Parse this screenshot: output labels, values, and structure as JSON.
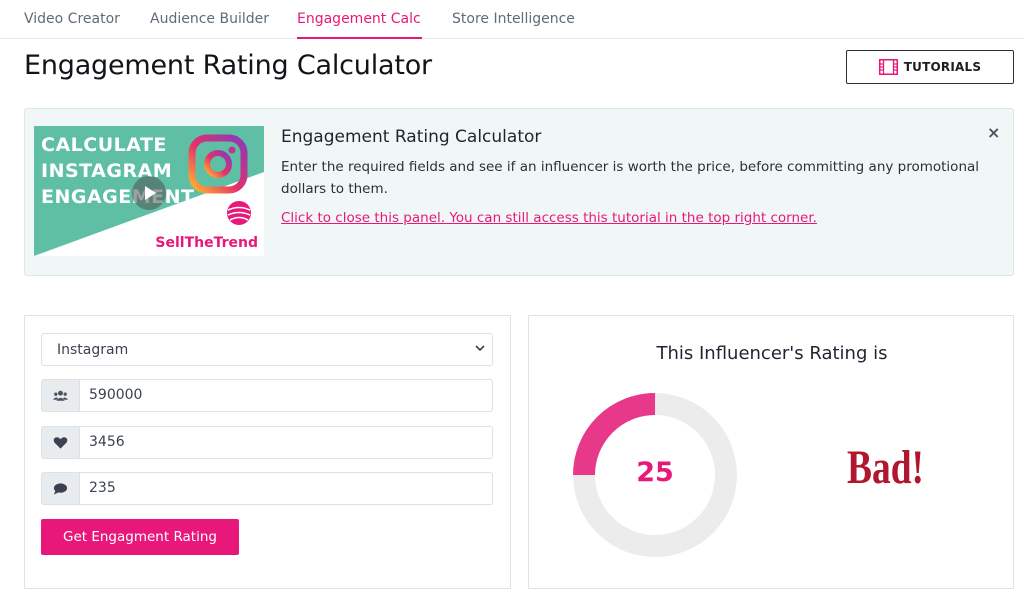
{
  "tabs": [
    {
      "label": "Video Creator",
      "active": false
    },
    {
      "label": "Audience Builder",
      "active": false
    },
    {
      "label": "Engagement Calc",
      "active": true
    },
    {
      "label": "Store Intelligence",
      "active": false
    }
  ],
  "page_title": "Engagement Rating Calculator",
  "tutorials_button": {
    "label": "TUTORIALS",
    "icon": "film-icon"
  },
  "tutorial_panel": {
    "thumbnail": {
      "lines": [
        "CALCULATE",
        "INSTAGRAM",
        "ENGAGEMENT"
      ],
      "brand": "SellTheTrend",
      "icons": [
        "instagram-icon",
        "play-icon"
      ]
    },
    "title": "Engagement Rating Calculator",
    "description": "Enter the required fields and see if an influencer is worth the price, before committing any promotional dollars to them.",
    "close_link": "Click to close this panel. You can still access this tutorial in the top right corner.",
    "close_icon": "×"
  },
  "form": {
    "platform": "Instagram",
    "followers": {
      "value": "590000",
      "icon": "users-icon"
    },
    "likes": {
      "value": "3456",
      "icon": "heart-icon"
    },
    "comments": {
      "value": "235",
      "icon": "comment-icon"
    },
    "submit_label": "Get Engagment Rating"
  },
  "result": {
    "title": "This Influencer's Rating is",
    "score": "25",
    "score_fraction": 0.25,
    "verdict": "Bad!"
  },
  "colors": {
    "accent": "#e8177a",
    "verdict": "#b0162e",
    "panel_bg": "#f1f7f6",
    "donut_track": "#ececec",
    "donut_fill": "#e8388a"
  }
}
